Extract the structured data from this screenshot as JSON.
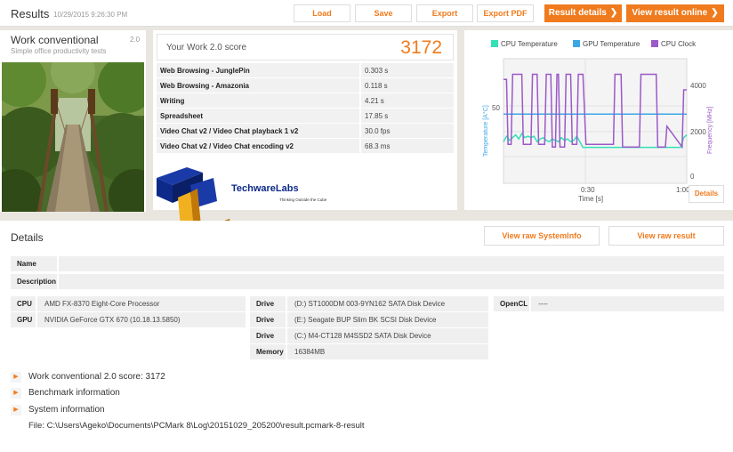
{
  "header": {
    "title": "Results",
    "timestamp": "10/29/2015 9:26:30 PM",
    "load_label": "Load",
    "save_label": "Save",
    "export_label": "Export",
    "export_pdf_label": "Export PDF",
    "result_details_label": "Result details",
    "view_online_label": "View result online",
    "accent_color": "#f07b1e"
  },
  "test": {
    "name": "Work conventional",
    "version": "2.0",
    "description": "Simple office productivity tests"
  },
  "score": {
    "label": "Your Work 2.0 score",
    "value": "3172",
    "rows": [
      {
        "name": "Web Browsing - JunglePin",
        "value": "0.303 s"
      },
      {
        "name": "Web Browsing - Amazonia",
        "value": "0.118 s"
      },
      {
        "name": "Writing",
        "value": "4.21 s"
      },
      {
        "name": "Spreadsheet",
        "value": "17.85 s"
      },
      {
        "name": "Video Chat v2 / Video Chat playback 1 v2",
        "value": "30.0 fps"
      },
      {
        "name": "Video Chat v2 / Video Chat encoding v2",
        "value": "68.3 ms"
      }
    ]
  },
  "chart_data": {
    "type": "line",
    "series": [
      {
        "name": "CPU Temperature",
        "color": "#33e0b8",
        "axis": "left",
        "x": [
          0,
          1,
          2,
          3,
          4,
          5,
          6,
          7,
          8,
          9,
          10,
          11,
          12,
          13,
          14,
          15,
          16,
          17,
          18,
          19,
          20,
          21,
          22,
          23,
          24,
          25,
          26,
          27,
          28,
          29,
          30,
          31,
          32,
          33,
          34,
          35,
          36,
          37,
          38,
          39,
          40,
          41,
          42,
          43,
          44,
          45,
          46,
          47,
          48,
          49,
          50,
          51,
          52,
          53,
          54,
          55,
          56,
          57,
          58,
          59,
          60
        ],
        "y": [
          30,
          34,
          31,
          33,
          35,
          32,
          36,
          33,
          34,
          33,
          34,
          30,
          32,
          33,
          31,
          30,
          32,
          31,
          30,
          33,
          31,
          32,
          30,
          31,
          34,
          30,
          26,
          26,
          26,
          26,
          26,
          26,
          26,
          26,
          26,
          26,
          26,
          26,
          26,
          26,
          26,
          26,
          26,
          26,
          26,
          26,
          26,
          26,
          26,
          26,
          26,
          26,
          26,
          26,
          26,
          26,
          26,
          26,
          26,
          33,
          35
        ]
      },
      {
        "name": "GPU Temperature",
        "color": "#3da7e6",
        "axis": "left",
        "x": [
          0,
          60
        ],
        "y": [
          50,
          50
        ]
      },
      {
        "name": "CPU Clock",
        "color": "#9b59c9",
        "axis": "right",
        "x": [
          0,
          1,
          1.5,
          2.5,
          3,
          6,
          6.5,
          9,
          9.5,
          11,
          11.5,
          13.5,
          14,
          15.5,
          16,
          17,
          17.5,
          18,
          18.5,
          20,
          20.5,
          22,
          22.5,
          24,
          24.5,
          26,
          27,
          36,
          36.5,
          38.5,
          39,
          44.5,
          45,
          50,
          50.5,
          53,
          53.5,
          58.5,
          59,
          60
        ],
        "y": [
          4000,
          4000,
          1500,
          1500,
          4200,
          4200,
          1500,
          1500,
          4200,
          4200,
          1500,
          1500,
          4200,
          4200,
          1400,
          1400,
          4200,
          4200,
          1400,
          1400,
          4200,
          4200,
          1500,
          1500,
          4200,
          4200,
          1500,
          1500,
          4200,
          4200,
          1400,
          1400,
          4200,
          4200,
          1400,
          1400,
          2200,
          1400,
          3600,
          3600
        ]
      }
    ],
    "xlabel": "Time [s]",
    "ylabel_left": "Temperature [A°C]",
    "ylabel_right": "Frequency [MHz]",
    "x_ticks": [
      "0:30",
      "1:00"
    ],
    "x_range": [
      0,
      60
    ],
    "y_left_ticks": [
      "50"
    ],
    "y_left_range": [
      0,
      90
    ],
    "y_right_ticks": [
      "4000",
      "2000",
      "0"
    ],
    "y_right_range": [
      0,
      4800
    ],
    "details_label": "Details"
  },
  "watermark": {
    "brand": "TechwareLabs",
    "tagline": "Thinking Outside the Cube"
  },
  "details": {
    "title": "Details",
    "view_systeminfo_label": "View raw SystemInfo",
    "view_raw_result_label": "View raw result",
    "name_label": "Name",
    "name_value": "",
    "description_label": "Description",
    "description_value": "",
    "cpu_label": "CPU",
    "cpu_value": "AMD FX-8370 Eight-Core Processor",
    "gpu_label": "GPU",
    "gpu_value": "NVIDIA GeForce GTX 670 (10.18.13.5850)",
    "drives": [
      {
        "label": "Drive",
        "value": "(D:) ST1000DM 003-9YN162 SATA Disk Device"
      },
      {
        "label": "Drive",
        "value": "(E:) Seagate BUP Slim BK SCSI Disk Device"
      },
      {
        "label": "Drive",
        "value": "(C:) M4-CT128 M4SSD2 SATA Disk Device"
      }
    ],
    "memory_label": "Memory",
    "memory_value": "16384MB",
    "opencl_label": "OpenCL",
    "opencl_value": "----",
    "expanders": [
      "Work conventional 2.0 score: 3172",
      "Benchmark information",
      "System information"
    ],
    "file_path": "File: C:\\Users\\Ageko\\Documents\\PCMark 8\\Log\\20151029_205200\\result.pcmark-8-result"
  }
}
